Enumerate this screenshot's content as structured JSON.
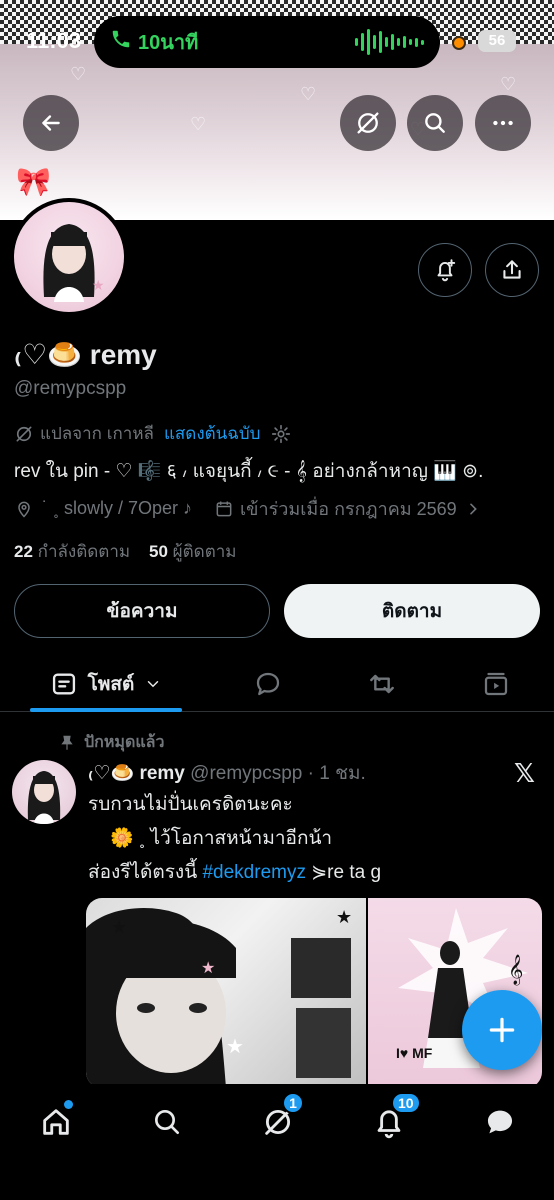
{
  "status_bar": {
    "time": "11:03",
    "call_label": "10นาที",
    "battery": "56"
  },
  "profile": {
    "display_name": "₍♡🍮 remy",
    "handle": "@remypcspp",
    "translated_from": "แปลจาก เกาหลี",
    "show_original": "แสดงต้นฉบับ",
    "bio": "rev ใน pin - ♡ 🎼 ६ ៸ แจยุนกี้ ៸ ૯ - 𝄞 อย่างกล้าหาญ 🎹 ⊚.",
    "location": "˙ ˳ slowly / 7Oper ♪",
    "joined": "เข้าร่วมเมื่อ กรกฎาคม 2569",
    "following_count": "22",
    "following_label": "กำลังติดตาม",
    "followers_count": "50",
    "followers_label": "ผู้ติดตาม",
    "message_button": "ข้อความ",
    "follow_button": "ติดตาม"
  },
  "tabs": {
    "posts_label": "โพสต์"
  },
  "post": {
    "pinned_label": "ปักหมุดแล้ว",
    "author_name": "₍♡🍮 remy",
    "author_handle": "@remypcspp",
    "time": "· 1 ชม.",
    "line1": "รบกวนไม่ปั่นเครดิตนะคะ",
    "line2": "🌼 ˳      ไว้โอกาสหน้ามาอีกน้า",
    "line3_prefix": "ส่องรีได้ตรงนี้ ",
    "hashtag": "#dekdremyz",
    "line3_suffix": " ⋟re ta g"
  },
  "bottom_nav": {
    "spaces_badge": "1",
    "notifications_badge": "10"
  },
  "colors": {
    "accent": "#1d9bf0",
    "call_green": "#33d35d",
    "background": "#000000",
    "muted_text": "#71767b"
  }
}
